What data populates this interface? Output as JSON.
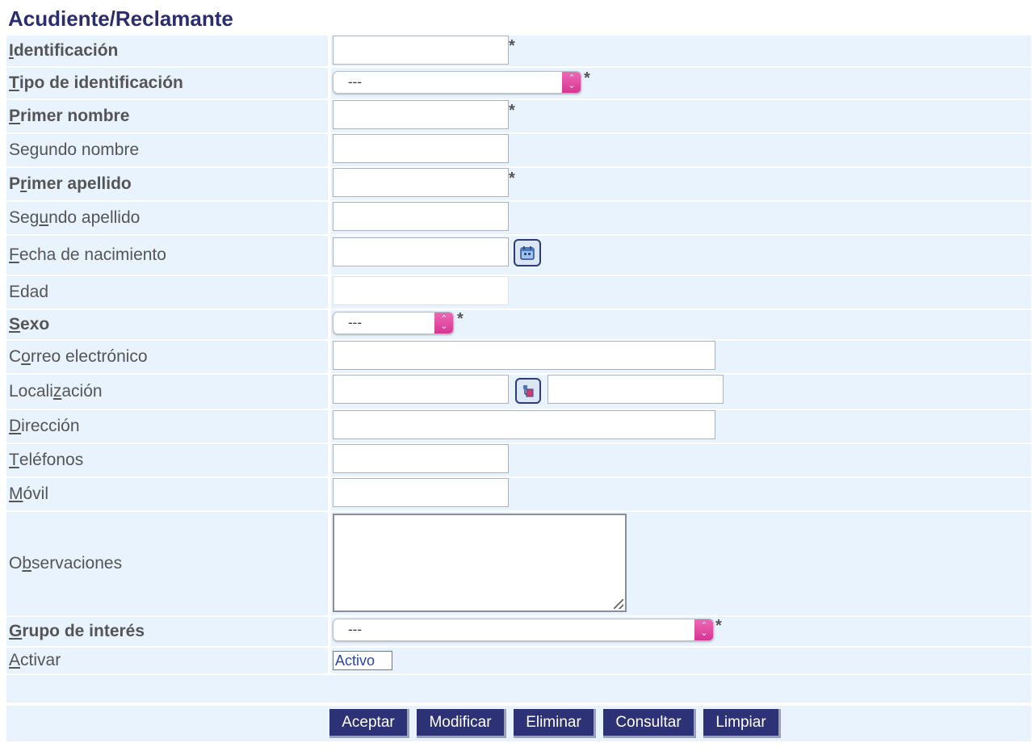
{
  "section_title": "Acudiente/Reclamante",
  "required_mark": "*",
  "fields": {
    "identificacion": {
      "accesskey": "I",
      "rest": "dentificación"
    },
    "tipo_identificacion": {
      "accesskey": "T",
      "rest": "ipo de identificación",
      "value": "---"
    },
    "primer_nombre": {
      "accesskey": "P",
      "rest": "rimer nombre"
    },
    "segundo_nombre": {
      "label": "Segundo nombre"
    },
    "primer_apellido": {
      "pre": "P",
      "accesskey": "r",
      "rest": "imer apellido"
    },
    "segundo_apellido": {
      "pre": "Seg",
      "accesskey": "u",
      "rest": "ndo apellido"
    },
    "fecha_nacimiento": {
      "accesskey": "F",
      "rest": "echa de nacimiento"
    },
    "edad": {
      "label": "Edad"
    },
    "sexo": {
      "accesskey": "S",
      "rest": "exo",
      "value": "---"
    },
    "correo": {
      "pre": "C",
      "accesskey": "o",
      "rest": "rreo electrónico"
    },
    "localizacion": {
      "pre": "Locali",
      "accesskey": "z",
      "rest": "ación"
    },
    "direccion": {
      "accesskey": "D",
      "rest": "irección"
    },
    "telefonos": {
      "accesskey": "T",
      "rest": "eléfonos"
    },
    "movil": {
      "accesskey": "M",
      "rest": "óvil"
    },
    "observaciones": {
      "pre": "O",
      "accesskey": "b",
      "rest": "servaciones"
    },
    "grupo_interes": {
      "accesskey": "G",
      "rest": "rupo de interés",
      "value": "---"
    },
    "activar": {
      "accesskey": "A",
      "rest": "ctivar",
      "value": "Activo"
    }
  },
  "icons": {
    "calendar": "calendar-icon",
    "location": "location-picker-icon"
  },
  "buttons": {
    "aceptar": "Aceptar",
    "modificar": "Modificar",
    "eliminar": "Eliminar",
    "consultar": "Consultar",
    "limpiar": "Limpiar"
  },
  "colors": {
    "title": "#2b2d6e",
    "row_bg": "#e8f3fd",
    "button_bg": "#2d3276",
    "select_arrow": "#e0449b"
  }
}
